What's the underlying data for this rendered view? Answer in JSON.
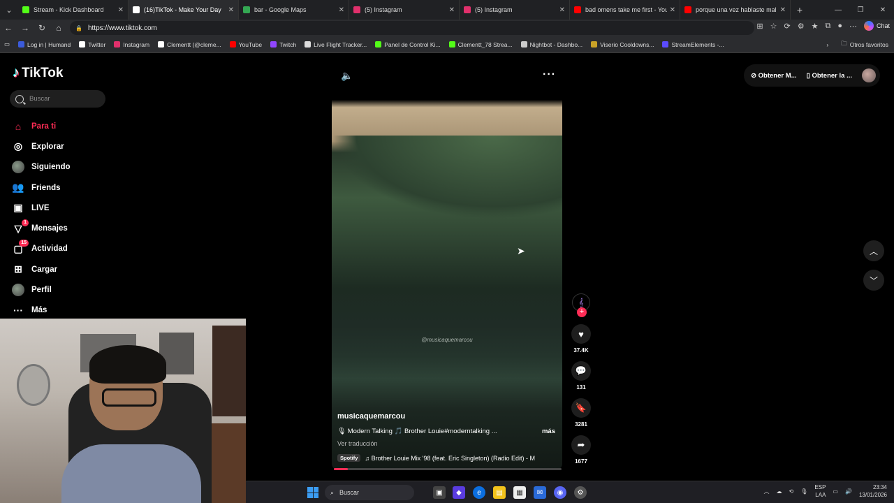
{
  "browser": {
    "tabs": [
      {
        "title": "Stream - Kick Dashboard",
        "color": "#53fc18",
        "active": false
      },
      {
        "title": "(16)TikTok - Make Your Day",
        "color": "#ffffff",
        "active": true
      },
      {
        "title": "bar - Google Maps",
        "color": "#34a853",
        "active": false
      },
      {
        "title": "(5) Instagram",
        "color": "#e1306c",
        "active": false
      },
      {
        "title": "(5) Instagram",
        "color": "#e1306c",
        "active": false
      },
      {
        "title": "bad omens take me first - YouTube",
        "color": "#ff0000",
        "active": false
      },
      {
        "title": "porque una vez hablaste mal de mi",
        "color": "#ff0000",
        "active": false
      }
    ],
    "url": "https://www.tiktok.com",
    "chat_label": "Chat",
    "bookmarks": [
      {
        "label": "Log in | Humand",
        "color": "#3b5bdb"
      },
      {
        "label": "Twitter",
        "color": "#ffffff"
      },
      {
        "label": "Instagram",
        "color": "#e1306c"
      },
      {
        "label": "Clementt (@cleme...",
        "color": "#ffffff"
      },
      {
        "label": "YouTube",
        "color": "#ff0000"
      },
      {
        "label": "Twitch",
        "color": "#9146ff"
      },
      {
        "label": "Live Flight Tracker...",
        "color": "#dddddd"
      },
      {
        "label": "Panel de Control Ki...",
        "color": "#53fc18"
      },
      {
        "label": "Clementt_78 Strea...",
        "color": "#53fc18"
      },
      {
        "label": "Nightbot - Dashbo...",
        "color": "#cccccc"
      },
      {
        "label": "Viserio Cooldowns...",
        "color": "#c9a227"
      },
      {
        "label": "StreamElements -...",
        "color": "#5b4bff"
      }
    ],
    "other_favorites": "Otros favoritos"
  },
  "tiktok": {
    "logo": "TikTok",
    "search_placeholder": "Buscar",
    "menu": [
      {
        "label": "Para ti",
        "icon": "home-icon",
        "active": true,
        "badge": ""
      },
      {
        "label": "Explorar",
        "icon": "compass-icon",
        "active": false,
        "badge": ""
      },
      {
        "label": "Siguiendo",
        "icon": "following-avatar-icon",
        "active": false,
        "badge": ""
      },
      {
        "label": "Friends",
        "icon": "friends-icon",
        "active": false,
        "badge": ""
      },
      {
        "label": "LIVE",
        "icon": "live-icon",
        "active": false,
        "badge": ""
      },
      {
        "label": "Mensajes",
        "icon": "messages-icon",
        "active": false,
        "badge": "1"
      },
      {
        "label": "Actividad",
        "icon": "activity-icon",
        "active": false,
        "badge": "15"
      },
      {
        "label": "Cargar",
        "icon": "upload-icon",
        "active": false,
        "badge": ""
      },
      {
        "label": "Perfil",
        "icon": "profile-avatar-icon",
        "active": false,
        "badge": ""
      },
      {
        "label": "Más",
        "icon": "more-icon",
        "active": false,
        "badge": ""
      }
    ],
    "top_right": {
      "coins": "Obtener M...",
      "app": "Obtener la ..."
    },
    "video": {
      "watermark": "@musicaquemarcou",
      "author": "musicaquemarcou",
      "description": "🎙 Modern Talking 🎵 Brother Louie#moderntalking ...",
      "more": "más",
      "translate": "Ver traducción",
      "spotify": "Spotify",
      "music": "♫  Brother Louie Mix '98 (feat. Eric Singleton) (Radio Edit) - M",
      "progress": 0.06
    },
    "actions": {
      "likes": "37.4K",
      "comments": "131",
      "saves": "3281",
      "shares": "1677"
    }
  },
  "taskbar": {
    "search": "Buscar",
    "lang": "ESP",
    "lang2": "LAA",
    "time": "23:34",
    "date": "13/01/2026"
  }
}
